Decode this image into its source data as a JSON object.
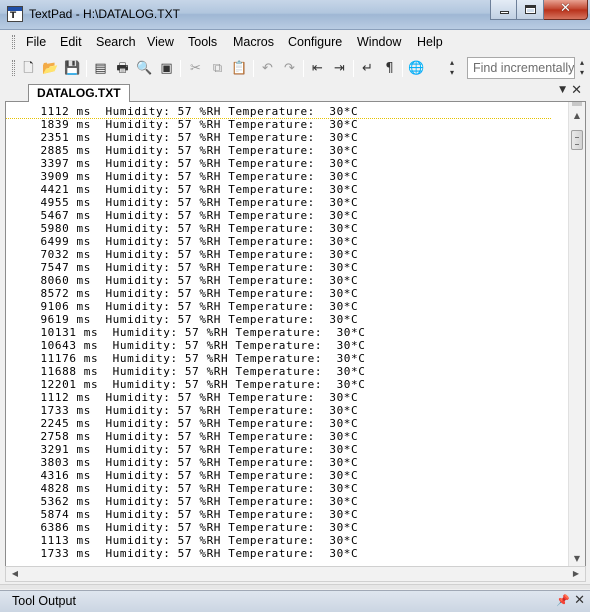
{
  "window": {
    "title": "TextPad - H:\\DATALOG.TXT",
    "controls": {
      "minimize": "_",
      "maximize": "□",
      "close": "✕"
    }
  },
  "menu": {
    "items": [
      "File",
      "Edit",
      "Search",
      "View",
      "Tools",
      "Macros",
      "Configure",
      "Window",
      "Help"
    ]
  },
  "toolbar": {
    "icons": {
      "new": "new-file-icon",
      "open": "open-folder-icon",
      "save": "save-icon",
      "properties": "document-properties-icon",
      "print": "print-icon",
      "print_preview": "print-preview-icon",
      "record": "record-icon",
      "cut": "cut-icon",
      "copy": "copy-icon",
      "paste": "paste-icon",
      "undo": "undo-icon",
      "redo": "redo-icon",
      "outdent": "decrease-indent-icon",
      "indent": "increase-indent-icon",
      "word_wrap": "word-wrap-icon",
      "show_marks": "pilcrow-icon",
      "browser": "globe-icon"
    },
    "find_placeholder": "Find incrementally"
  },
  "document": {
    "tab_label": "DATALOG.TXT",
    "lines": [
      "  1112 ms  Humidity: 57 %RH Temperature:  30*C",
      "  1839 ms  Humidity: 57 %RH Temperature:  30*C",
      "  2351 ms  Humidity: 57 %RH Temperature:  30*C",
      "  2885 ms  Humidity: 57 %RH Temperature:  30*C",
      "  3397 ms  Humidity: 57 %RH Temperature:  30*C",
      "  3909 ms  Humidity: 57 %RH Temperature:  30*C",
      "  4421 ms  Humidity: 57 %RH Temperature:  30*C",
      "  4955 ms  Humidity: 57 %RH Temperature:  30*C",
      "  5467 ms  Humidity: 57 %RH Temperature:  30*C",
      "  5980 ms  Humidity: 57 %RH Temperature:  30*C",
      "  6499 ms  Humidity: 57 %RH Temperature:  30*C",
      "  7032 ms  Humidity: 57 %RH Temperature:  30*C",
      "  7547 ms  Humidity: 57 %RH Temperature:  30*C",
      "  8060 ms  Humidity: 57 %RH Temperature:  30*C",
      "  8572 ms  Humidity: 57 %RH Temperature:  30*C",
      "  9106 ms  Humidity: 57 %RH Temperature:  30*C",
      "  9619 ms  Humidity: 57 %RH Temperature:  30*C",
      "  10131 ms  Humidity: 57 %RH Temperature:  30*C",
      "  10643 ms  Humidity: 57 %RH Temperature:  30*C",
      "  11176 ms  Humidity: 57 %RH Temperature:  30*C",
      "  11688 ms  Humidity: 57 %RH Temperature:  30*C",
      "  12201 ms  Humidity: 57 %RH Temperature:  30*C",
      "  1112 ms  Humidity: 57 %RH Temperature:  30*C",
      "  1733 ms  Humidity: 57 %RH Temperature:  30*C",
      "  2245 ms  Humidity: 57 %RH Temperature:  30*C",
      "  2758 ms  Humidity: 57 %RH Temperature:  30*C",
      "  3291 ms  Humidity: 57 %RH Temperature:  30*C",
      "  3803 ms  Humidity: 57 %RH Temperature:  30*C",
      "  4316 ms  Humidity: 57 %RH Temperature:  30*C",
      "  4828 ms  Humidity: 57 %RH Temperature:  30*C",
      "  5362 ms  Humidity: 57 %RH Temperature:  30*C",
      "  5874 ms  Humidity: 57 %RH Temperature:  30*C",
      "  6386 ms  Humidity: 57 %RH Temperature:  30*C",
      "  1113 ms  Humidity: 57 %RH Temperature:  30*C",
      "  1733 ms  Humidity: 57 %RH Temperature:  30*C"
    ]
  },
  "tool_output": {
    "title": "Tool Output"
  }
}
